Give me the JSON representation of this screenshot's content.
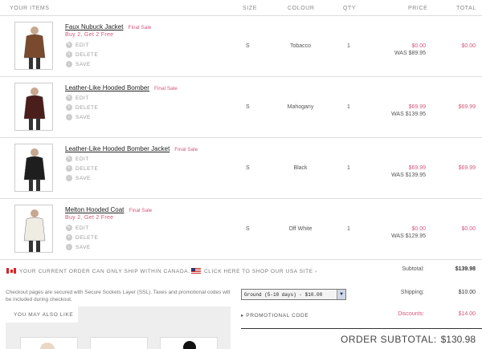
{
  "header": {
    "items": "YOUR ITEMS",
    "size": "SIZE",
    "colour": "COLOUR",
    "qty": "QTY",
    "price": "PRICE",
    "total": "TOTAL"
  },
  "actions": {
    "edit": "EDIT",
    "delete": "DELETE",
    "save": "SAVE"
  },
  "items": [
    {
      "name": "Faux Nubuck Jacket",
      "final": "Final Sale",
      "promo": "Buy 2, Get 2 Free",
      "size": "S",
      "colour": "Tobacco",
      "qty": "1",
      "sale_price": "$0.00",
      "was": "WAS $89.95",
      "total": "$0.00",
      "garment": "#7a4a2e"
    },
    {
      "name": "Leather-Like Hooded Bomber",
      "final": "Final Sale",
      "promo": "",
      "size": "S",
      "colour": "Mahogany",
      "qty": "1",
      "sale_price": "$69.99",
      "was": "WAS $139.95",
      "total": "$69.99",
      "garment": "#4a1e1a"
    },
    {
      "name": "Leather-Like Hooded Bomber Jacket",
      "final": "Final Sale",
      "promo": "",
      "size": "S",
      "colour": "Black",
      "qty": "1",
      "sale_price": "$69.99",
      "was": "WAS $139.95",
      "total": "$69.99",
      "garment": "#1e1e1e"
    },
    {
      "name": "Melton Hooded Coat",
      "final": "Final Sale",
      "promo": "Buy 2, Get 2 Free",
      "size": "S",
      "colour": "Off White",
      "qty": "1",
      "sale_price": "$0.00",
      "was": "WAS $129.95",
      "total": "$0.00",
      "garment": "#efece4"
    }
  ],
  "shipping_notice": {
    "canada": "YOUR CURRENT ORDER CAN ONLY SHIP WITHIN CANADA.",
    "usa_link": "CLICK HERE TO SHOP OUR USA SITE"
  },
  "security_note": "Checkout pages are secured with Secure Sockets Layer (SSL). Taxes and promotional codes will be included during checkout.",
  "ymal": {
    "title": "YOU MAY ALSO LIKE"
  },
  "summary": {
    "subtotal_label": "Subtotal:",
    "subtotal_value": "$139.98",
    "shipping_label": "Shipping:",
    "shipping_value": "$10.00",
    "shipping_option": "Ground (5-10 days) - $10.00",
    "discounts_label": "Discounts:",
    "discounts_value": "$14.00",
    "promo_code": "PROMOTIONAL CODE",
    "order_subtotal_label": "ORDER SUBTOTAL:",
    "order_subtotal_value": "$130.98"
  },
  "colors": {
    "accent": "#d15a7a",
    "text": "#444444",
    "rule": "#dddddd"
  }
}
